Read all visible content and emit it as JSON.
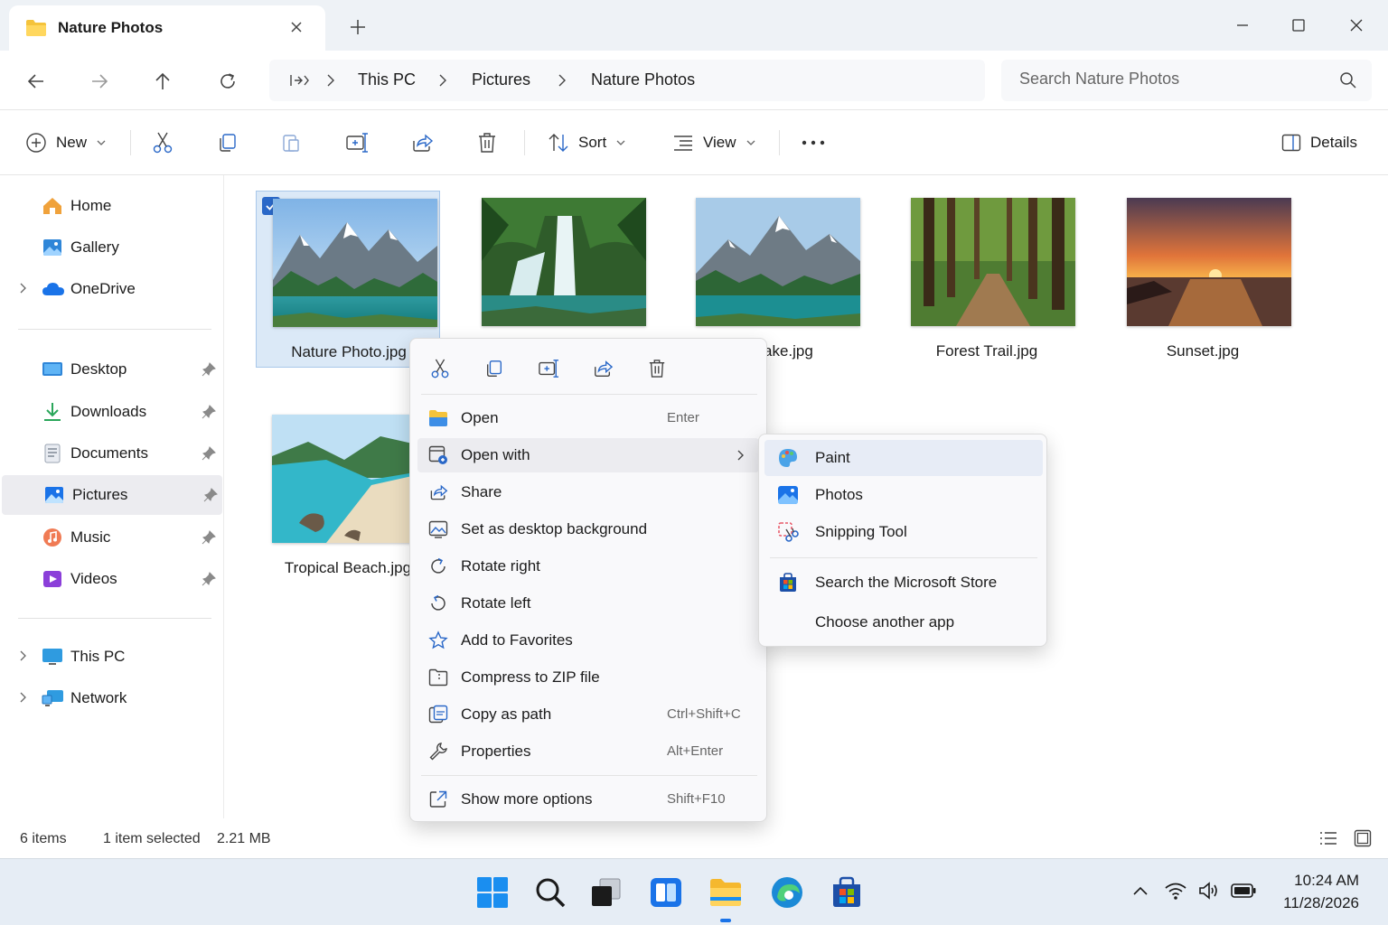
{
  "window": {
    "tab_title": "Nature Photos",
    "icons": {
      "tab": "folder-icon",
      "close_tab": "close-icon",
      "new_tab": "plus-icon",
      "minimize": "minimize-icon",
      "maximize": "maximize-icon",
      "close": "close-icon"
    }
  },
  "nav": {
    "breadcrumbs": [
      "This PC",
      "Pictures",
      "Nature Photos"
    ],
    "search_placeholder": "Search Nature Photos"
  },
  "toolbar": {
    "new_label": "New",
    "sort_label": "Sort",
    "view_label": "View",
    "details_label": "Details"
  },
  "sidebar": {
    "items": [
      {
        "label": "Home",
        "icon": "home-icon"
      },
      {
        "label": "Gallery",
        "icon": "gallery-icon"
      },
      {
        "label": "OneDrive",
        "icon": "cloud-icon"
      },
      {
        "label": "Desktop",
        "icon": "desktop-icon"
      },
      {
        "label": "Downloads",
        "icon": "download-icon"
      },
      {
        "label": "Documents",
        "icon": "documents-icon"
      },
      {
        "label": "Pictures",
        "icon": "pictures-icon"
      },
      {
        "label": "Music",
        "icon": "music-icon"
      },
      {
        "label": "Videos",
        "icon": "videos-icon"
      },
      {
        "label": "This PC",
        "icon": "pc-icon"
      },
      {
        "label": "Network",
        "icon": "network-icon"
      }
    ]
  },
  "files": [
    {
      "name": "Nature Photo.jpg",
      "selected": true
    },
    {
      "name": "",
      "selected": false
    },
    {
      "name": "ain Lake.jpg",
      "selected": false
    },
    {
      "name": "Forest Trail.jpg",
      "selected": false
    },
    {
      "name": "Sunset.jpg",
      "selected": false
    },
    {
      "name": "Tropical Beach.jpg",
      "selected": false
    }
  ],
  "context_menu": {
    "items": [
      {
        "label": "Open",
        "shortcut": "Enter"
      },
      {
        "label": "Open with",
        "shortcut": ""
      },
      {
        "label": "Share",
        "shortcut": ""
      },
      {
        "label": "Set as desktop background",
        "shortcut": ""
      },
      {
        "label": "Rotate right",
        "shortcut": ""
      },
      {
        "label": "Rotate left",
        "shortcut": ""
      },
      {
        "label": "Add to Favorites",
        "shortcut": ""
      },
      {
        "label": "Compress to ZIP file",
        "shortcut": ""
      },
      {
        "label": "Copy as path",
        "shortcut": "Ctrl+Shift+C"
      },
      {
        "label": "Properties",
        "shortcut": "Alt+Enter"
      },
      {
        "label": "Show more options",
        "shortcut": "Shift+F10"
      }
    ]
  },
  "open_with_submenu": {
    "items": [
      {
        "label": "Paint",
        "icon": "paint-icon"
      },
      {
        "label": "Photos",
        "icon": "photos-icon"
      },
      {
        "label": "Snipping Tool",
        "icon": "snipping-tool-icon"
      },
      {
        "label": "Search the Microsoft Store",
        "icon": "store-icon"
      },
      {
        "label": "Choose another app",
        "icon": ""
      }
    ]
  },
  "status": {
    "count": "6 items",
    "selection": "1 item selected",
    "size": "2.21 MB"
  },
  "taskbar": {
    "time": "10:24 AM",
    "date": "11/28/2026"
  },
  "colors": {
    "accent": "#2a68c8",
    "selection_bg": "#dbe9f7",
    "folder_yellow": "#f5c33b"
  }
}
